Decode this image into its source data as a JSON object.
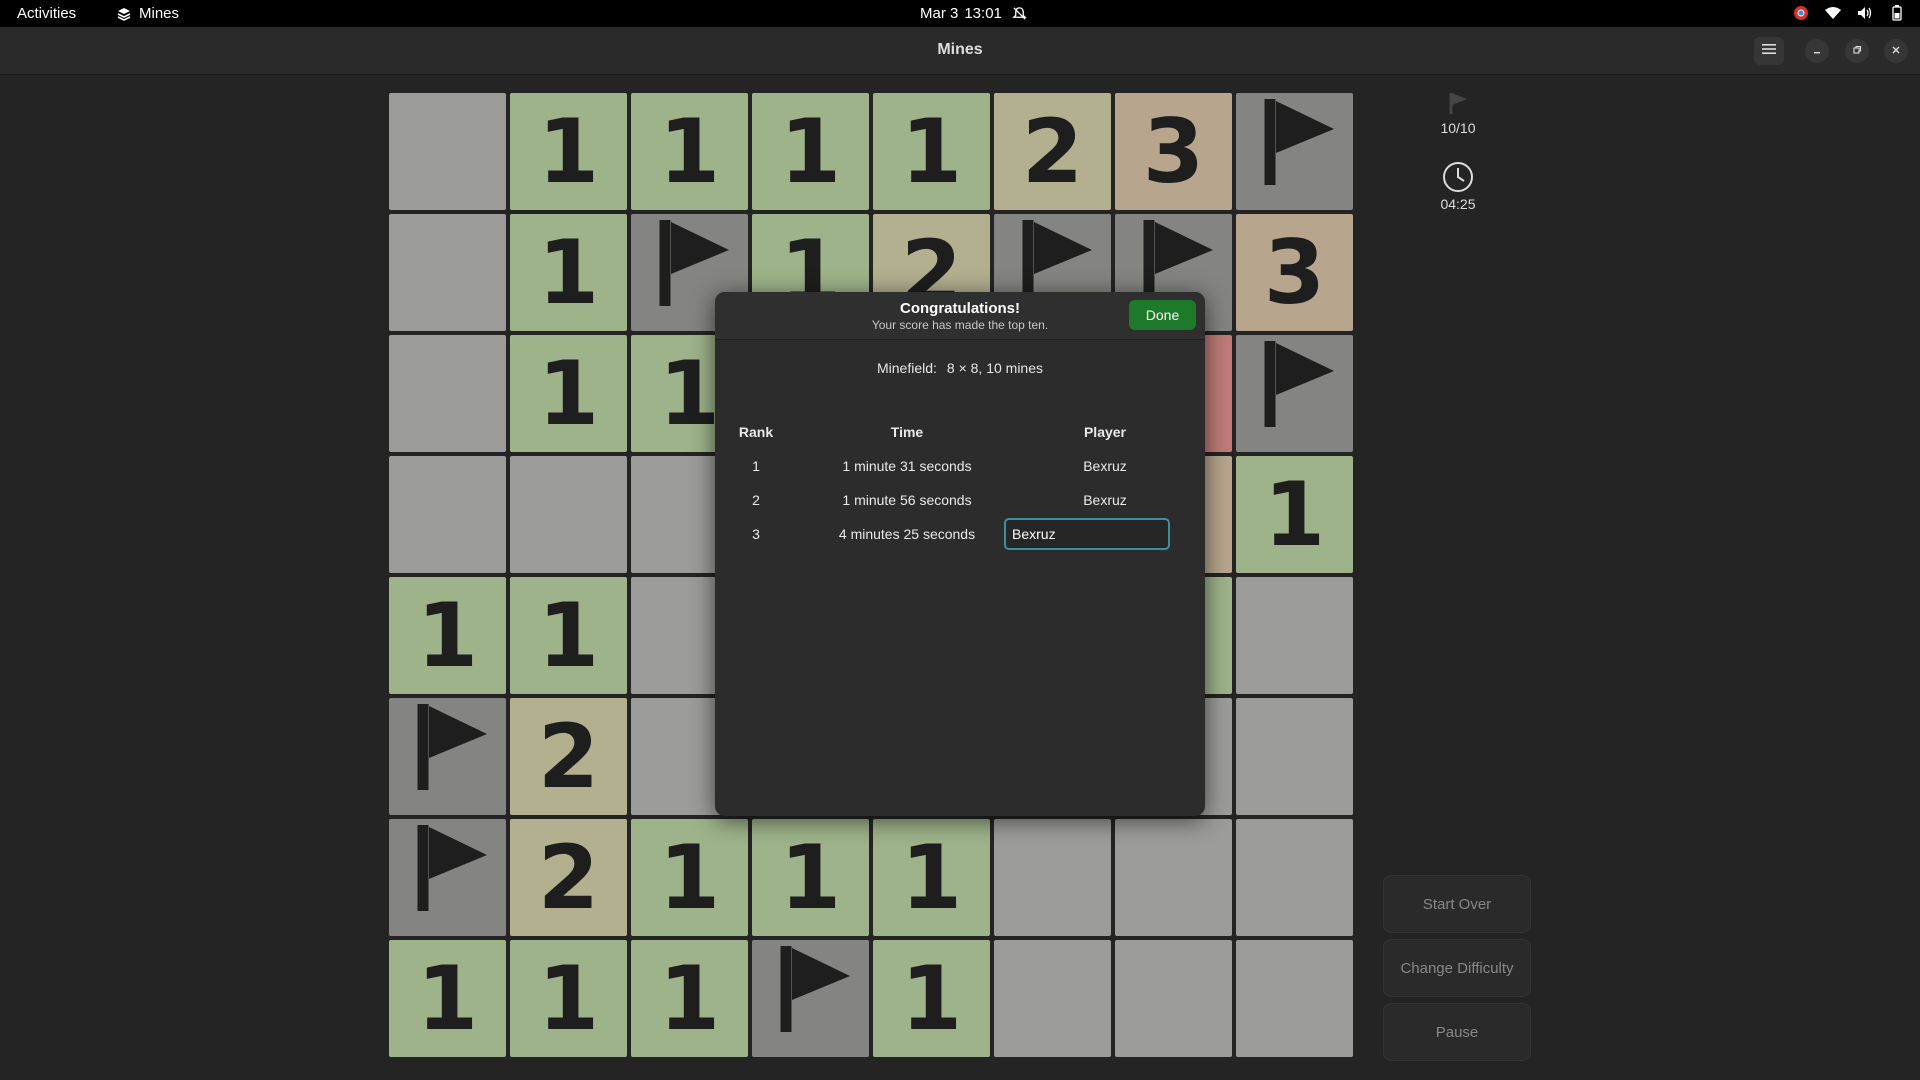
{
  "topbar": {
    "activities": "Activities",
    "app_name": "Mines",
    "date": "Mar 3",
    "time": "13:01"
  },
  "window": {
    "title": "Mines"
  },
  "board": {
    "rows": [
      [
        {
          "t": "empty",
          "v": ""
        },
        {
          "t": "n1",
          "v": "1"
        },
        {
          "t": "n1",
          "v": "1"
        },
        {
          "t": "n1",
          "v": "1"
        },
        {
          "t": "n1",
          "v": "1"
        },
        {
          "t": "n2",
          "v": "2"
        },
        {
          "t": "n3",
          "v": "3"
        },
        {
          "t": "flag",
          "v": ""
        }
      ],
      [
        {
          "t": "empty",
          "v": ""
        },
        {
          "t": "n1",
          "v": "1"
        },
        {
          "t": "flag",
          "v": ""
        },
        {
          "t": "n1",
          "v": "1"
        },
        {
          "t": "n2",
          "v": "2"
        },
        {
          "t": "flag",
          "v": ""
        },
        {
          "t": "flag",
          "v": ""
        },
        {
          "t": "n3",
          "v": "3"
        }
      ],
      [
        {
          "t": "empty",
          "v": ""
        },
        {
          "t": "n1",
          "v": "1"
        },
        {
          "t": "n1",
          "v": "1"
        },
        {
          "t": "empty",
          "v": ""
        },
        {
          "t": "empty",
          "v": ""
        },
        {
          "t": "empty",
          "v": ""
        },
        {
          "t": "mine-red",
          "v": ""
        },
        {
          "t": "flag",
          "v": ""
        }
      ],
      [
        {
          "t": "empty",
          "v": ""
        },
        {
          "t": "empty",
          "v": ""
        },
        {
          "t": "empty",
          "v": ""
        },
        {
          "t": "empty",
          "v": ""
        },
        {
          "t": "empty",
          "v": ""
        },
        {
          "t": "empty",
          "v": ""
        },
        {
          "t": "n3",
          "v": ""
        },
        {
          "t": "n1",
          "v": "1"
        }
      ],
      [
        {
          "t": "n1",
          "v": "1"
        },
        {
          "t": "n1",
          "v": "1"
        },
        {
          "t": "empty",
          "v": ""
        },
        {
          "t": "empty",
          "v": ""
        },
        {
          "t": "empty",
          "v": ""
        },
        {
          "t": "empty",
          "v": ""
        },
        {
          "t": "n1",
          "v": ""
        },
        {
          "t": "empty",
          "v": ""
        }
      ],
      [
        {
          "t": "flag",
          "v": ""
        },
        {
          "t": "n2",
          "v": "2"
        },
        {
          "t": "empty",
          "v": ""
        },
        {
          "t": "empty",
          "v": ""
        },
        {
          "t": "empty",
          "v": ""
        },
        {
          "t": "empty",
          "v": ""
        },
        {
          "t": "empty",
          "v": ""
        },
        {
          "t": "empty",
          "v": ""
        }
      ],
      [
        {
          "t": "flag",
          "v": ""
        },
        {
          "t": "n2",
          "v": "2"
        },
        {
          "t": "n1",
          "v": "1"
        },
        {
          "t": "n1",
          "v": "1"
        },
        {
          "t": "n1",
          "v": "1"
        },
        {
          "t": "empty",
          "v": ""
        },
        {
          "t": "empty",
          "v": ""
        },
        {
          "t": "empty",
          "v": ""
        }
      ],
      [
        {
          "t": "n1",
          "v": "1"
        },
        {
          "t": "n1",
          "v": "1"
        },
        {
          "t": "n1",
          "v": "1"
        },
        {
          "t": "flag",
          "v": ""
        },
        {
          "t": "n1",
          "v": "1"
        },
        {
          "t": "empty",
          "v": ""
        },
        {
          "t": "empty",
          "v": ""
        },
        {
          "t": "empty",
          "v": ""
        }
      ]
    ]
  },
  "side": {
    "flags": "10/10",
    "elapsed": "04:25",
    "start_over": "Start Over",
    "change_difficulty": "Change Difficulty",
    "pause": "Pause"
  },
  "dialog": {
    "title": "Congratulations!",
    "subtitle": "Your score has made the top ten.",
    "done": "Done",
    "minefield_label": "Minefield:",
    "minefield_value": "8 × 8, 10 mines",
    "headers": {
      "rank": "Rank",
      "time": "Time",
      "player": "Player"
    },
    "scores": [
      {
        "rank": "1",
        "time": "1 minute 31 seconds",
        "player": "Bexruz"
      },
      {
        "rank": "2",
        "time": "1 minute 56 seconds",
        "player": "Bexruz"
      },
      {
        "rank": "3",
        "time": "4 minutes 25 seconds",
        "player": "Bexruz"
      }
    ]
  }
}
